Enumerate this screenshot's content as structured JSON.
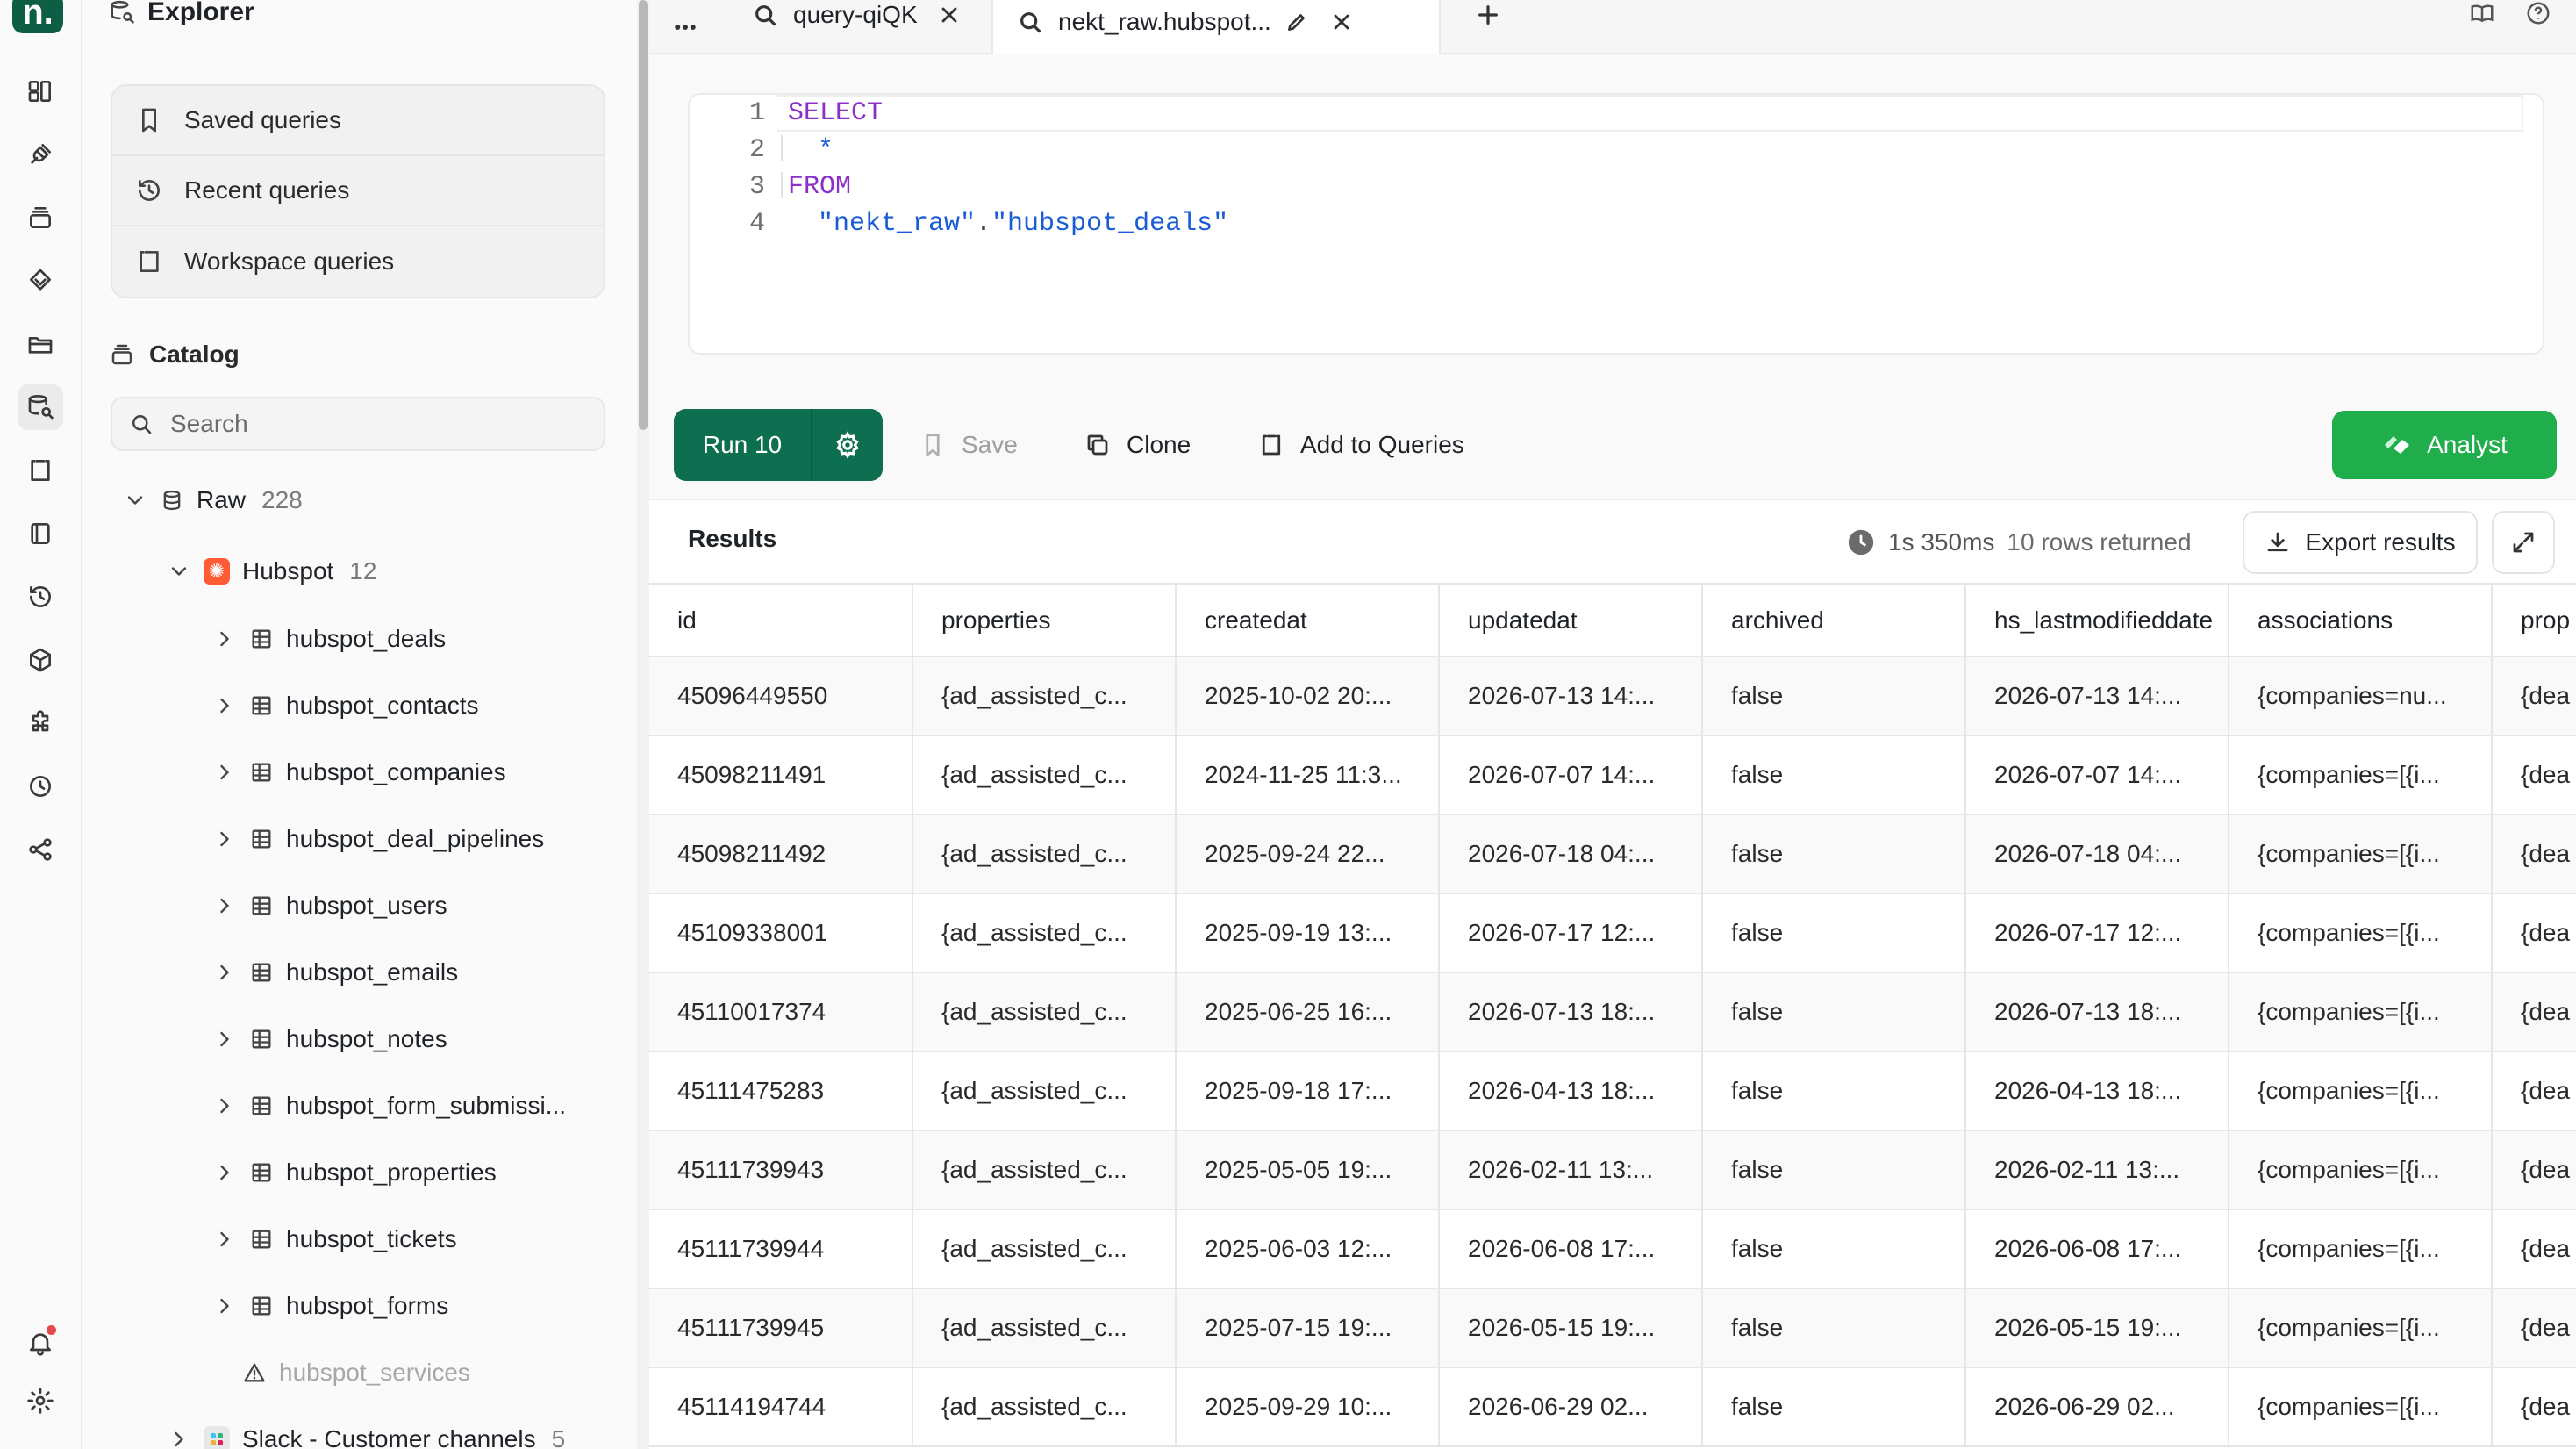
{
  "sidebar": {
    "title": "Explorer",
    "queries": [
      {
        "label": "Saved queries",
        "icon": "bookmark-icon"
      },
      {
        "label": "Recent queries",
        "icon": "history-icon"
      },
      {
        "label": "Workspace queries",
        "icon": "workspace-icon"
      }
    ],
    "catalog_label": "Catalog",
    "search_placeholder": "Search",
    "raw": {
      "label": "Raw",
      "count": "228"
    },
    "hubspot": {
      "label": "Hubspot",
      "count": "12"
    },
    "tables": [
      "hubspot_deals",
      "hubspot_contacts",
      "hubspot_companies",
      "hubspot_deal_pipelines",
      "hubspot_users",
      "hubspot_emails",
      "hubspot_notes",
      "hubspot_form_submissi...",
      "hubspot_properties",
      "hubspot_tickets",
      "hubspot_forms"
    ],
    "disabled_table": "hubspot_services",
    "slack": {
      "label": "Slack - Customer channels",
      "count": "5"
    }
  },
  "tabs": [
    {
      "label": "query-qiQK"
    },
    {
      "label": "nekt_raw.hubspot..."
    }
  ],
  "editor": {
    "lines": [
      {
        "n": "1",
        "text": "SELECT"
      },
      {
        "n": "2",
        "text": "*"
      },
      {
        "n": "3",
        "text": "FROM"
      },
      {
        "n": "4",
        "schema": "\"nekt_raw\"",
        "dot": ".",
        "table": "\"hubspot_deals\""
      }
    ]
  },
  "toolbar": {
    "run_label": "Run 10",
    "save_label": "Save",
    "clone_label": "Clone",
    "add_label": "Add to Queries",
    "analyst_label": "Analyst"
  },
  "results": {
    "title": "Results",
    "time": "1s 350ms",
    "rows_returned": "10 rows returned",
    "export_label": "Export results"
  },
  "table": {
    "columns": [
      "id",
      "properties",
      "createdat",
      "updatedat",
      "archived",
      "hs_lastmodifieddate",
      "associations",
      "prop"
    ],
    "rows": [
      [
        "45096449550",
        "{ad_assisted_c...",
        "2025-10-02 20:...",
        "2026-07-13 14:...",
        "false",
        "2026-07-13 14:...",
        "{companies=nu...",
        "{dea"
      ],
      [
        "45098211491",
        "{ad_assisted_c...",
        "2024-11-25 11:3...",
        "2026-07-07 14:...",
        "false",
        "2026-07-07 14:...",
        "{companies=[{i...",
        "{dea"
      ],
      [
        "45098211492",
        "{ad_assisted_c...",
        "2025-09-24 22...",
        "2026-07-18 04:...",
        "false",
        "2026-07-18 04:...",
        "{companies=[{i...",
        "{dea"
      ],
      [
        "45109338001",
        "{ad_assisted_c...",
        "2025-09-19 13:...",
        "2026-07-17 12:...",
        "false",
        "2026-07-17 12:...",
        "{companies=[{i...",
        "{dea"
      ],
      [
        "45110017374",
        "{ad_assisted_c...",
        "2025-06-25 16:...",
        "2026-07-13 18:...",
        "false",
        "2026-07-13 18:...",
        "{companies=[{i...",
        "{dea"
      ],
      [
        "45111475283",
        "{ad_assisted_c...",
        "2025-09-18 17:...",
        "2026-04-13 18:...",
        "false",
        "2026-04-13 18:...",
        "{companies=[{i...",
        "{dea"
      ],
      [
        "45111739943",
        "{ad_assisted_c...",
        "2025-05-05 19:...",
        "2026-02-11 13:...",
        "false",
        "2026-02-11 13:...",
        "{companies=[{i...",
        "{dea"
      ],
      [
        "45111739944",
        "{ad_assisted_c...",
        "2025-06-03 12:...",
        "2026-06-08 17:...",
        "false",
        "2026-06-08 17:...",
        "{companies=[{i...",
        "{dea"
      ],
      [
        "45111739945",
        "{ad_assisted_c...",
        "2025-07-15 19:...",
        "2026-05-15 19:...",
        "false",
        "2026-05-15 19:...",
        "{companies=[{i...",
        "{dea"
      ],
      [
        "45114194744",
        "{ad_assisted_c...",
        "2025-09-29 10:...",
        "2026-06-29 02...",
        "false",
        "2026-06-29 02...",
        "{companies=[{i...",
        "{dea"
      ]
    ]
  },
  "colors": {
    "brand": "#0e5e45",
    "run": "#0e6e50",
    "analyst": "#1fae4b",
    "keyword": "#8b2fc9",
    "string": "#1a5bd6",
    "notification": "#e5484d",
    "hubspot": "#ff5c35"
  }
}
